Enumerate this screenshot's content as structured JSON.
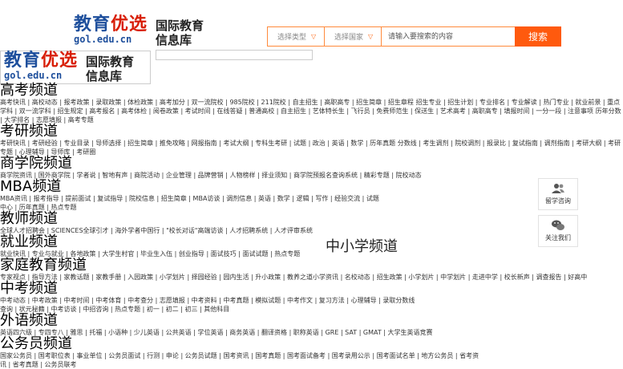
{
  "header": {
    "logo": {
      "main_blue": "教育",
      "main_red": "优选",
      "url": "gol.edu.cn",
      "side_line1": "国际教育",
      "side_line2": "信息库"
    },
    "search": {
      "type_select": "选择类型",
      "country_select": "选择国家",
      "placeholder": "请输入要搜索的内容",
      "button": "搜索"
    }
  },
  "channels": [
    {
      "title": "高考频道",
      "links": "高考快讯 | 高校动态 | 报考政策 | 录取政策 | 体检政策 | 高考加分 | 双一流院校 | 985院校 | 211院校 | 自主招生 | 高职高专 | 招生简章 | 招生章程 招生专业 | 招生计划 | 专业排名 | 专业解读 | 热门专业 | 就业前景 | 重点学科 | 双一流学科 | 招生规定 | 高考报名 | 高考体检 | 阅卷政策 | 考试时间 | 在线答疑 | 普通高校 | 自主招生 | 艺体特长生 | 飞行员 | 免费师范生 | 保送生 | 艺术高考 | 高职高专 | 填报时间 | 一分一段 | 注意事项 历年分数 | 大学排名 | 志愿填报 | 高考专题"
    },
    {
      "title": "考研频道",
      "links": "考研快讯 | 考研经验 | 专业目录 | 导师选择 | 招生简章 | 推免攻略 | 网报指南 | 考试大纲 | 专科生考研 | 试题 | 政治 | 英语 | 数学 | 历年真题 分数线 | 考生调剂 | 院校调剂 | 报录比 | 复试指南 | 调剂指南 | 考研大纲 | 考研专题 | 心理辅导 | 导师库 | 考研圈"
    },
    {
      "title": "商学院频道",
      "links": "商学院资讯 | 国外商学院 | 学者说 | 智地有声 | 商院活动 | 企业管理 | 品牌营销 | 人物榜样 | 择业须知 | 商学院预报名查询系统 | 精彩专题 | 院校动态"
    },
    {
      "title": "MBA频道",
      "links": "MBA资讯 | 报考指导 | 提前面试 | 复试指导 | 院校信息 | 招生简章 | MBA访谈 | 调剂信息 | 英语 | 数学 | 逻辑 | 写作 | 经验交流 | 试题中心 | 历年真题 | 热点专题"
    },
    {
      "title": "教师频道",
      "links": "全球人才招聘会 | SCIENCES全球引才 | 海外学者中国行 | \"校长对话\"高端访谈 | 人才招聘系统 | 人才评审系统"
    },
    {
      "title": "就业频道",
      "links": "就业快讯 | 专业与就业 | 各地政策 | 大学生村官 | 毕业生入伍 | 创业指导 | 面试技巧 | 面试试题 | 热点专题"
    },
    {
      "title": "家庭教育频道",
      "links": "专家视点 | 指导方法 | 家教话题 | 家教手册 | 入园政策 | 小学划片 | 择园经验 | 园内生活 | 升小政策 | 教养之道小学资讯 | 名校动态 | 招生政策 | 小学划片 | 中学划片 | 走进中学 | 校长新声 | 调查报告 | 好高中"
    },
    {
      "title": "中考频道",
      "links": "中考动态 | 中考政策 | 中考时间 | 中考体育 | 中考查分 | 志愿填报 | 中考资料 | 中考真题 | 模拟试题 | 中考作文 | 复习方法 | 心理辅导 | 录取分数线查询 | 状元秘籍 | 中考访谈 | 中招咨询 | 热点专题 | 初一 | 初二 | 初三 | 其他科目"
    },
    {
      "title": "外语频道",
      "links": "英语四六级 | 专四专八 | 雅思 | 托福 | 小语种 | 少儿英语 | 公共英语 | 学位英语 | 商务英语 | 翻译资格 | 职称英语 | GRE | SAT | GMAT | 大学生英语竞赛"
    },
    {
      "title": "公务员频道",
      "links": "国家公务员 | 国考职位表 | 事业单位 | 公务员面试 | 行测 | 申论 | 公务员试题 | 国考资讯 | 国考真题 | 国考面试备考 | 国考录用公示 | 国考面试名单 | 地方公务员 | 省考资讯 | 省考真题 | 公务员联考"
    }
  ],
  "k12_title": "中小学频道",
  "tools": {
    "consult_label": "留学咨询",
    "follow_label": "关注我们"
  },
  "colors": {
    "accent_orange": "#ff5a0e",
    "logo_blue": "#1e4f9c",
    "logo_red": "#d81e06"
  }
}
